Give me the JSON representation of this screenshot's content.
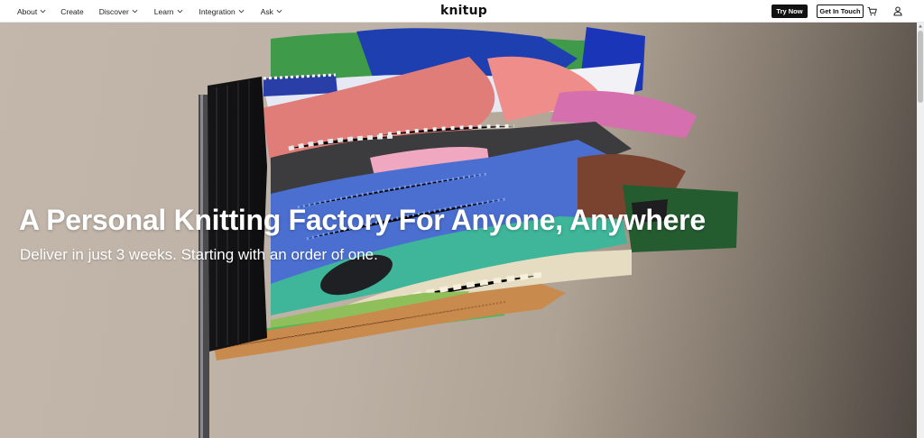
{
  "nav": {
    "items": [
      {
        "label": "About",
        "has_dropdown": true
      },
      {
        "label": "Create",
        "has_dropdown": false
      },
      {
        "label": "Discover",
        "has_dropdown": true
      },
      {
        "label": "Learn",
        "has_dropdown": true
      },
      {
        "label": "Integration",
        "has_dropdown": true
      },
      {
        "label": "Ask",
        "has_dropdown": true
      }
    ],
    "logo": "knitup",
    "try_now": "Try Now",
    "get_in_touch": "Get In Touch",
    "icons": [
      "chevron-down-icon",
      "cart-icon",
      "user-icon"
    ]
  },
  "hero": {
    "title": "A Personal Knitting Factory For Anyone, Anywhere",
    "subtitle": "Deliver in just 3 weeks. Starting with an order of one."
  },
  "colors": {
    "text_dark": "#1d1d1d",
    "hero_text": "#ffffff",
    "button_dark": "#111111",
    "ribbon_coral": "#e07d78",
    "ribbon_blue": "#4a6fd0",
    "ribbon_teal": "#3fb59a",
    "ribbon_green": "#4ab85c",
    "ribbon_orange": "#c98a4e"
  }
}
